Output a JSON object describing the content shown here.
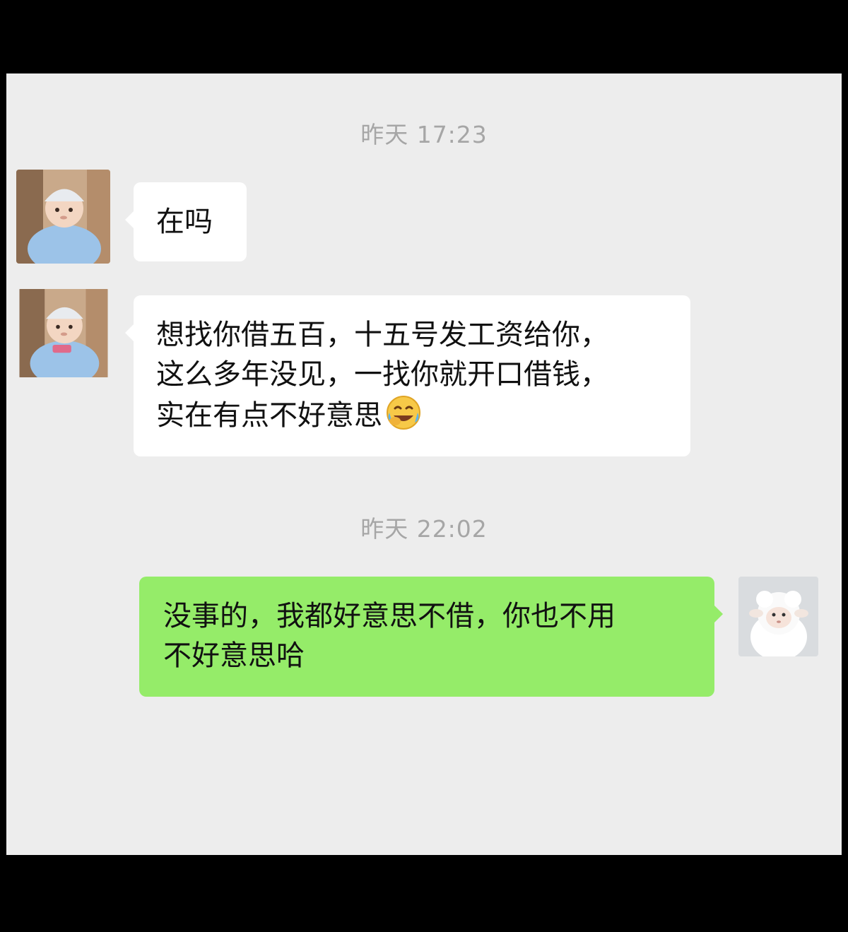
{
  "chat": {
    "timestamps": [
      "昨天 17:23",
      "昨天 22:02"
    ],
    "messages": [
      {
        "sender": "contact",
        "avatar": "baby-avatar-icon",
        "lines": [
          "在吗"
        ]
      },
      {
        "sender": "contact",
        "avatar": "baby-avatar-icon",
        "lines": [
          "想找你借五百，十五号发工资给你，",
          "这么多年没见，一找你就开口借钱，",
          "实在有点不好意思"
        ],
        "trailing_emoji": "laughing-crying-emoji"
      },
      {
        "sender": "me",
        "avatar": "sheep-avatar-icon",
        "lines": [
          "没事的，我都好意思不借，你也不用",
          "不好意思哈"
        ]
      }
    ]
  },
  "colors": {
    "background_outer": "#000000",
    "chat_background": "#ededed",
    "incoming_bubble": "#ffffff",
    "outgoing_bubble": "#95ec69",
    "timestamp_text": "#a6a6a6",
    "message_text": "#111111"
  }
}
